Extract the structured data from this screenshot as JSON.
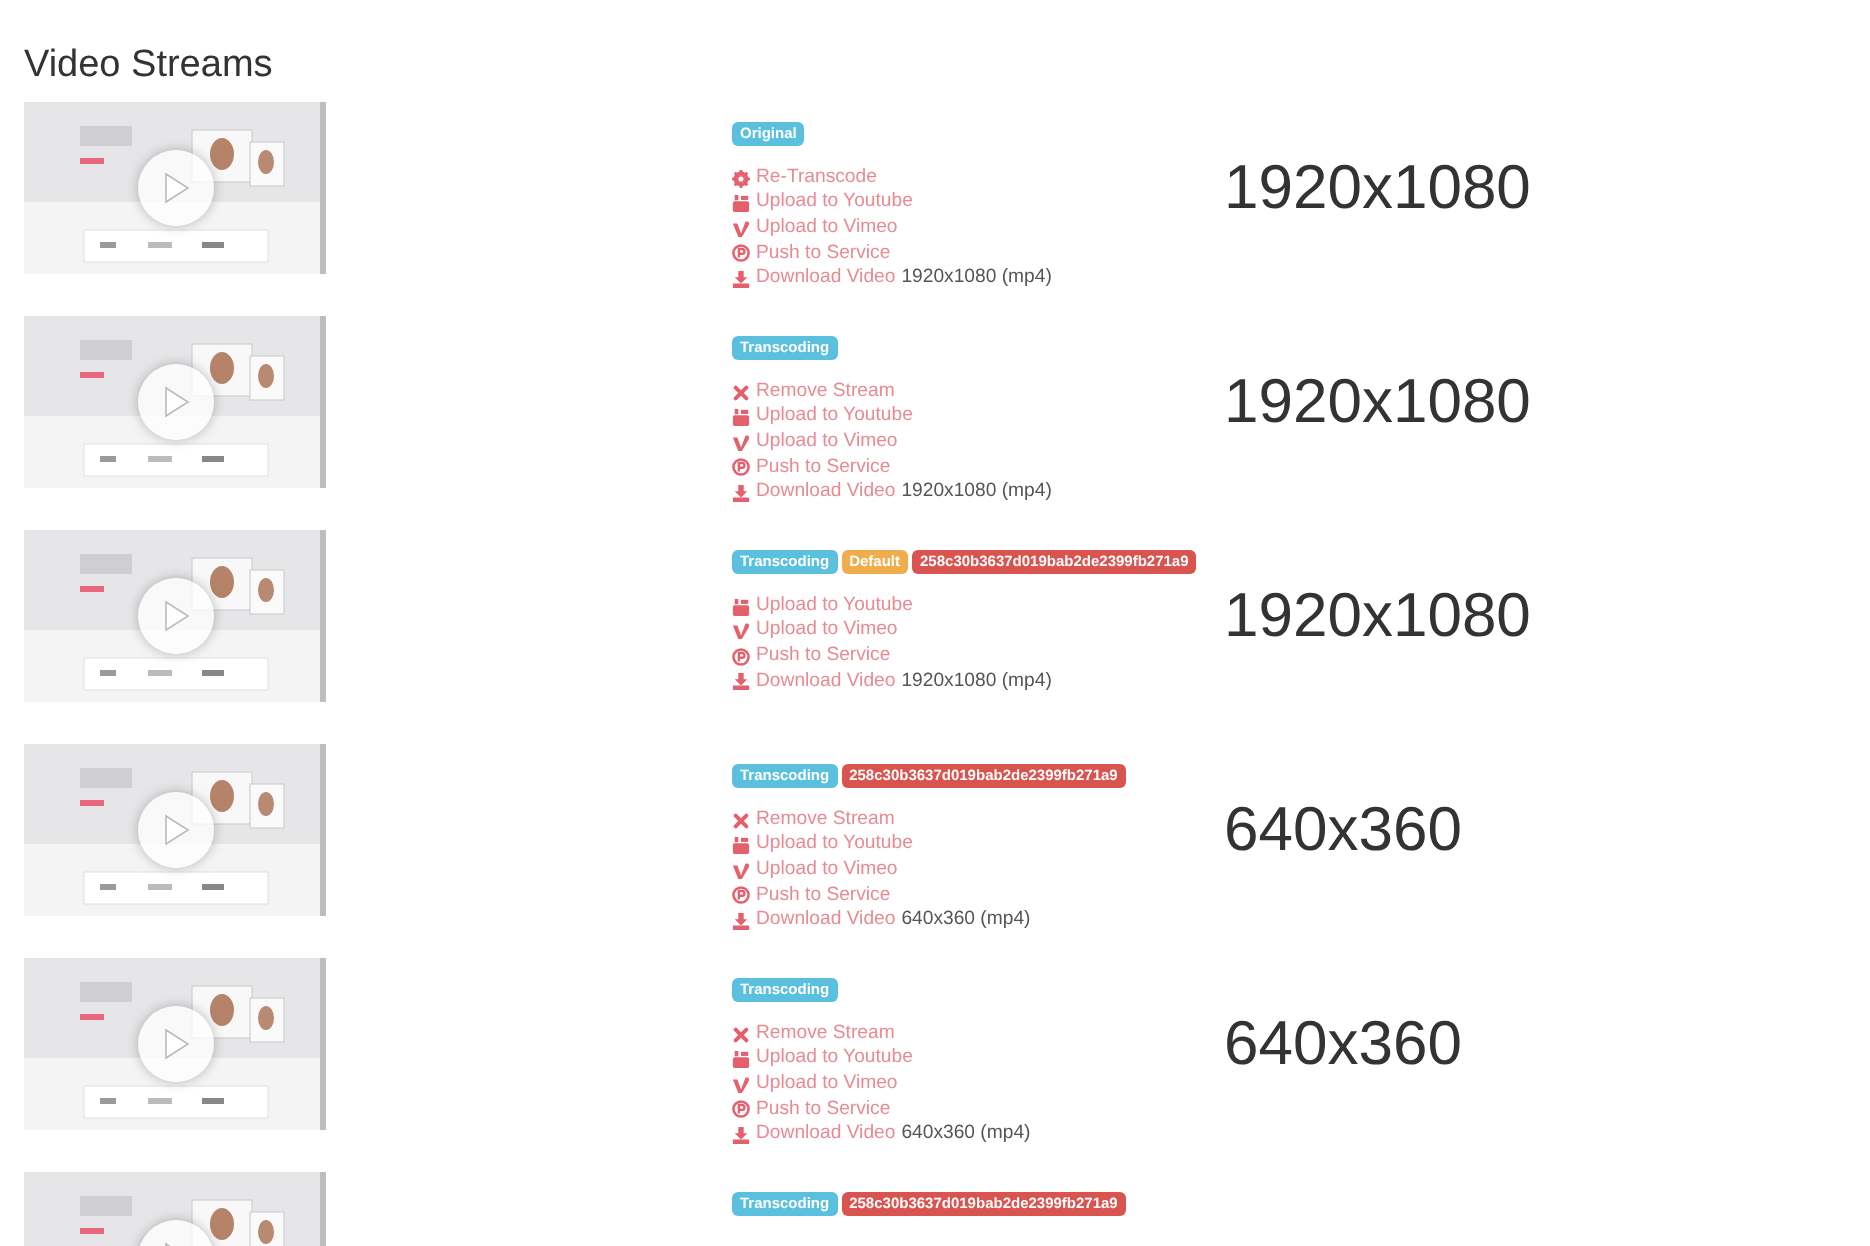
{
  "title": "Video Streams",
  "streams": [
    {
      "badges": [
        {
          "kind": "info",
          "text": "Original"
        }
      ],
      "actions": [
        {
          "kind": "retranscode",
          "label": "Re-Transcode"
        },
        {
          "kind": "youtube",
          "label": "Upload to Youtube"
        },
        {
          "kind": "vimeo",
          "label": "Upload to Vimeo"
        },
        {
          "kind": "push",
          "label": "Push to Service"
        },
        {
          "kind": "download",
          "label": "Download Video",
          "detail": "1920x1080 (mp4)"
        }
      ],
      "resolution": "1920x1080"
    },
    {
      "badges": [
        {
          "kind": "info",
          "text": "Transcoding"
        }
      ],
      "actions": [
        {
          "kind": "remove",
          "label": "Remove Stream"
        },
        {
          "kind": "youtube",
          "label": "Upload to Youtube"
        },
        {
          "kind": "vimeo",
          "label": "Upload to Vimeo"
        },
        {
          "kind": "push",
          "label": "Push to Service"
        },
        {
          "kind": "download",
          "label": "Download Video",
          "detail": "1920x1080 (mp4)"
        }
      ],
      "resolution": "1920x1080"
    },
    {
      "badges": [
        {
          "kind": "info",
          "text": "Transcoding"
        },
        {
          "kind": "warning",
          "text": "Default"
        },
        {
          "kind": "danger",
          "text": "258c30b3637d019bab2de2399fb271a9"
        }
      ],
      "actions": [
        {
          "kind": "youtube",
          "label": "Upload to Youtube"
        },
        {
          "kind": "vimeo",
          "label": "Upload to Vimeo"
        },
        {
          "kind": "push",
          "label": "Push to Service"
        },
        {
          "kind": "download",
          "label": "Download Video",
          "detail": "1920x1080 (mp4)"
        }
      ],
      "resolution": "1920x1080"
    },
    {
      "badges": [
        {
          "kind": "info",
          "text": "Transcoding"
        },
        {
          "kind": "danger",
          "text": "258c30b3637d019bab2de2399fb271a9"
        }
      ],
      "actions": [
        {
          "kind": "remove",
          "label": "Remove Stream"
        },
        {
          "kind": "youtube",
          "label": "Upload to Youtube"
        },
        {
          "kind": "vimeo",
          "label": "Upload to Vimeo"
        },
        {
          "kind": "push",
          "label": "Push to Service"
        },
        {
          "kind": "download",
          "label": "Download Video",
          "detail": "640x360 (mp4)"
        }
      ],
      "resolution": "640x360"
    },
    {
      "badges": [
        {
          "kind": "info",
          "text": "Transcoding"
        }
      ],
      "actions": [
        {
          "kind": "remove",
          "label": "Remove Stream"
        },
        {
          "kind": "youtube",
          "label": "Upload to Youtube"
        },
        {
          "kind": "vimeo",
          "label": "Upload to Vimeo"
        },
        {
          "kind": "push",
          "label": "Push to Service"
        },
        {
          "kind": "download",
          "label": "Download Video",
          "detail": "640x360 (mp4)"
        }
      ],
      "resolution": "640x360"
    },
    {
      "badges": [
        {
          "kind": "info",
          "text": "Transcoding"
        },
        {
          "kind": "danger",
          "text": "258c30b3637d019bab2de2399fb271a9"
        }
      ]
    }
  ]
}
